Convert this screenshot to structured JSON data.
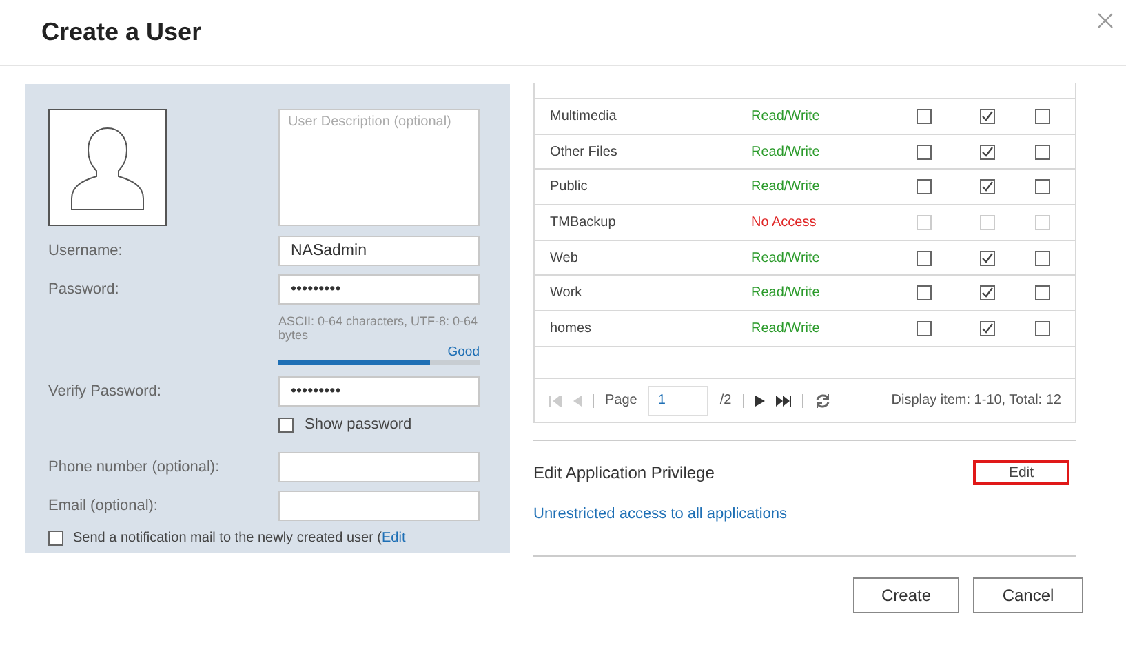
{
  "window": {
    "title": "Create a User"
  },
  "profile": {
    "description_placeholder": "User Description (optional)",
    "fields": [
      {
        "kind": "text",
        "label": "Username:",
        "value": "NASadmin"
      },
      {
        "kind": "password",
        "label": "Password:",
        "value": "•••••••••",
        "hint": "ASCII: 0-64 characters, UTF-8: 0-64 bytes",
        "strength": "Good",
        "level": 0.75
      },
      {
        "kind": "password",
        "label": "Verify Password:",
        "value": "•••••••••"
      },
      {
        "kind": "checkbox",
        "label": "Show password",
        "checked": false
      },
      {
        "kind": "text",
        "label": "Phone number (optional):"
      },
      {
        "kind": "text",
        "label": "Email (optional):"
      }
    ],
    "notify": {
      "label": "Send a notification mail to the newly created user (",
      "link": "Edit",
      "checked": false
    }
  },
  "folders": {
    "rows": [
      {
        "name": "Multimedia",
        "permission": "Read/Write",
        "kind": "granted",
        "disabled": false,
        "checks": [
          false,
          true,
          false
        ]
      },
      {
        "name": "Other Files",
        "permission": "Read/Write",
        "kind": "granted",
        "disabled": false,
        "checks": [
          false,
          true,
          false
        ]
      },
      {
        "name": "Public",
        "permission": "Read/Write",
        "kind": "granted",
        "disabled": false,
        "checks": [
          false,
          true,
          false
        ]
      },
      {
        "name": "TMBackup",
        "permission": "No Access",
        "kind": "denied",
        "disabled": true,
        "checks": [
          false,
          false,
          false
        ]
      },
      {
        "name": "Web",
        "permission": "Read/Write",
        "kind": "granted",
        "disabled": false,
        "checks": [
          false,
          true,
          false
        ]
      },
      {
        "name": "Work",
        "permission": "Read/Write",
        "kind": "granted",
        "disabled": false,
        "checks": [
          false,
          true,
          false
        ]
      },
      {
        "name": "homes",
        "permission": "Read/Write",
        "kind": "granted",
        "disabled": false,
        "checks": [
          false,
          true,
          false
        ]
      }
    ],
    "pager": {
      "page_label": "Page",
      "page": "1",
      "pages": "/2",
      "summary": "Display item: 1-10, Total: 12"
    }
  },
  "app_privilege": {
    "title": "Edit Application Privilege",
    "edit": "Edit",
    "link": "Unrestricted access to all applications"
  },
  "buttons": [
    "Create",
    "Cancel"
  ]
}
